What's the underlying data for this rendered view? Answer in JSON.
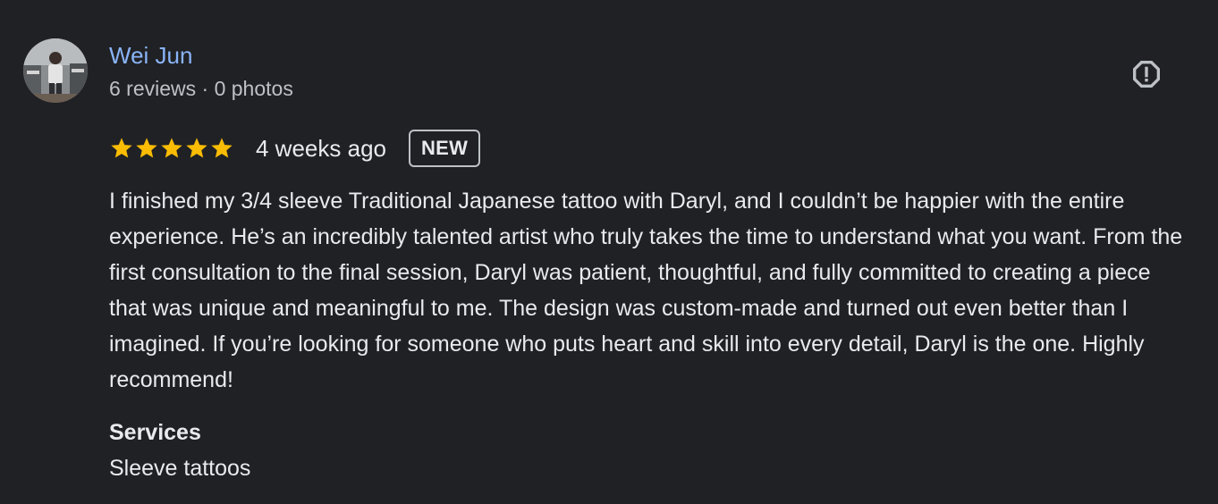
{
  "review": {
    "reviewer": {
      "name": "Wei Jun",
      "meta": "6 reviews · 0 photos"
    },
    "rating": 5,
    "date": "4 weeks ago",
    "badge": "NEW",
    "text": "I finished my 3/4 sleeve Traditional Japanese tattoo with Daryl, and I couldn’t be happier with the entire experience. He’s an incredibly talented artist who truly takes the time to understand what you want. From the first consultation to the final session, Daryl was patient, thoughtful, and fully committed to creating a piece that was unique and meaningful to me. The design was custom-made and turned out even better than I imagined. If you’re looking for someone who puts heart and skill into every detail, Daryl is the one. Highly recommend!",
    "services": {
      "title": "Services",
      "value": "Sleeve tattoos"
    }
  },
  "icons": {
    "report": "report-flag-icon",
    "star": "star-icon"
  },
  "colors": {
    "background": "#202124",
    "name_link": "#8ab4f8",
    "star": "#fbbc04",
    "text": "#e8eaed",
    "secondary_text": "#bdc1c6"
  }
}
